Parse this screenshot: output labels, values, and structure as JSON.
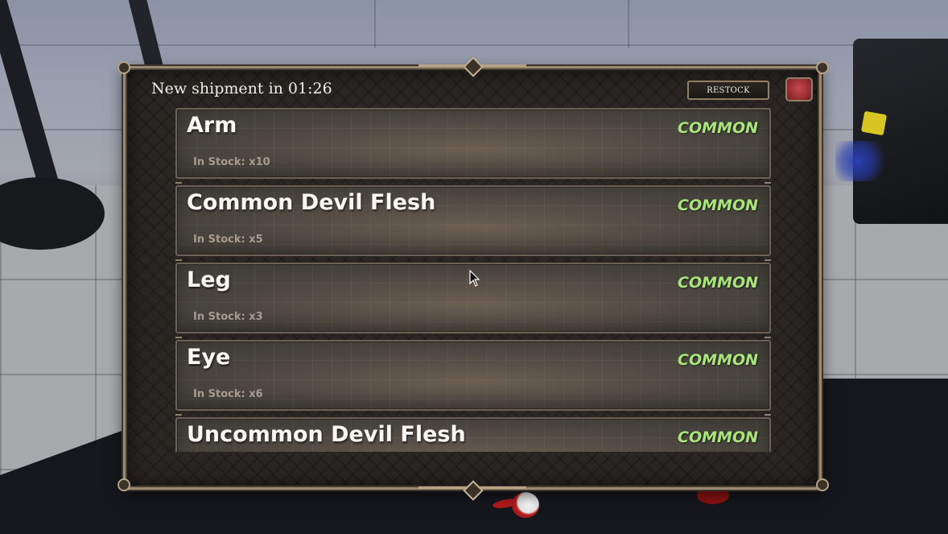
{
  "shop": {
    "shipment_label": "New shipment in 01:26",
    "restock_label": "RESTOCK",
    "close_icon": "close-icon"
  },
  "items": [
    {
      "name": "Arm",
      "rarity": "COMMON",
      "stock": "In Stock: x10"
    },
    {
      "name": "Common Devil Flesh",
      "rarity": "COMMON",
      "stock": "In Stock: x5"
    },
    {
      "name": "Leg",
      "rarity": "COMMON",
      "stock": "In Stock: x3"
    },
    {
      "name": "Eye",
      "rarity": "COMMON",
      "stock": "In Stock: x6"
    },
    {
      "name": "Uncommon Devil Flesh",
      "rarity": "COMMON",
      "stock": ""
    }
  ],
  "colors": {
    "rarity_common": "#a8e57a",
    "panel_border": "#9b8a72"
  }
}
